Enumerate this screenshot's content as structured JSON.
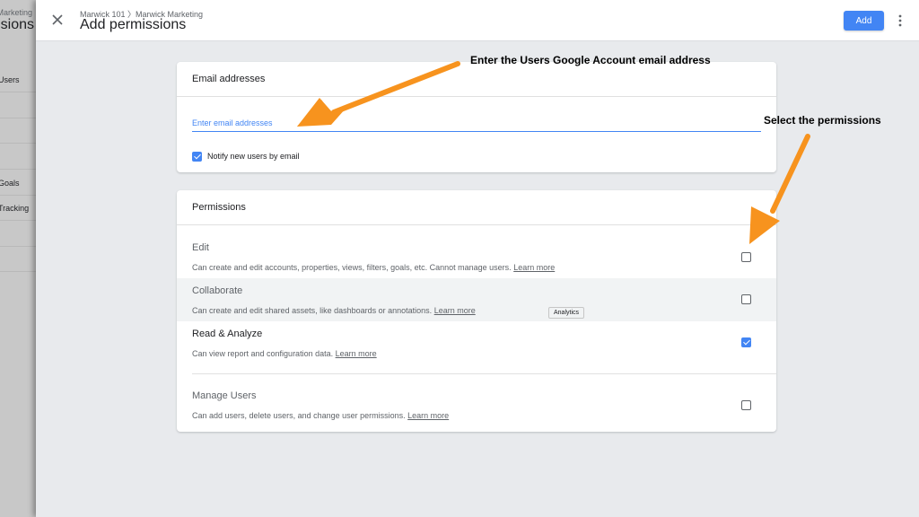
{
  "background_page": {
    "breadcrumb": "Marketing",
    "title": "Permissions",
    "nav_items": [
      "Users",
      "",
      "",
      "",
      "Goals",
      "Tracking",
      "",
      ""
    ]
  },
  "header": {
    "breadcrumb": "Marwick 101 〉Marwick Marketing",
    "title": "Add permissions",
    "add_label": "Add"
  },
  "email_card": {
    "title": "Email addresses",
    "input_placeholder": "Enter email addresses",
    "input_value": "",
    "notify_label": "Notify new users by email",
    "notify_checked": true
  },
  "permissions_card": {
    "title": "Permissions",
    "items": [
      {
        "name": "Edit",
        "description": "Can create and edit accounts, properties, views, filters, goals, etc. Cannot manage users.",
        "link": "Learn more",
        "checked": false
      },
      {
        "name": "Collaborate",
        "description": "Can create and edit shared assets, like dashboards or annotations.",
        "link": "Learn more",
        "checked": false
      },
      {
        "name": "Read & Analyze",
        "description": "Can view report and configuration data.",
        "link": "Learn more",
        "checked": true
      },
      {
        "name": "Manage Users",
        "description": "Can add users, delete users, and change user permissions.",
        "link": "Learn more",
        "checked": false
      }
    ]
  },
  "tooltip": "Analytics",
  "annotations": {
    "email_instruction": "Enter the Users Google Account email address",
    "permissions_instruction": "Select the permissions"
  },
  "colors": {
    "accent": "#4285f4",
    "annotation_arrow": "#f7931e",
    "panel_background": "#e8eaed"
  }
}
